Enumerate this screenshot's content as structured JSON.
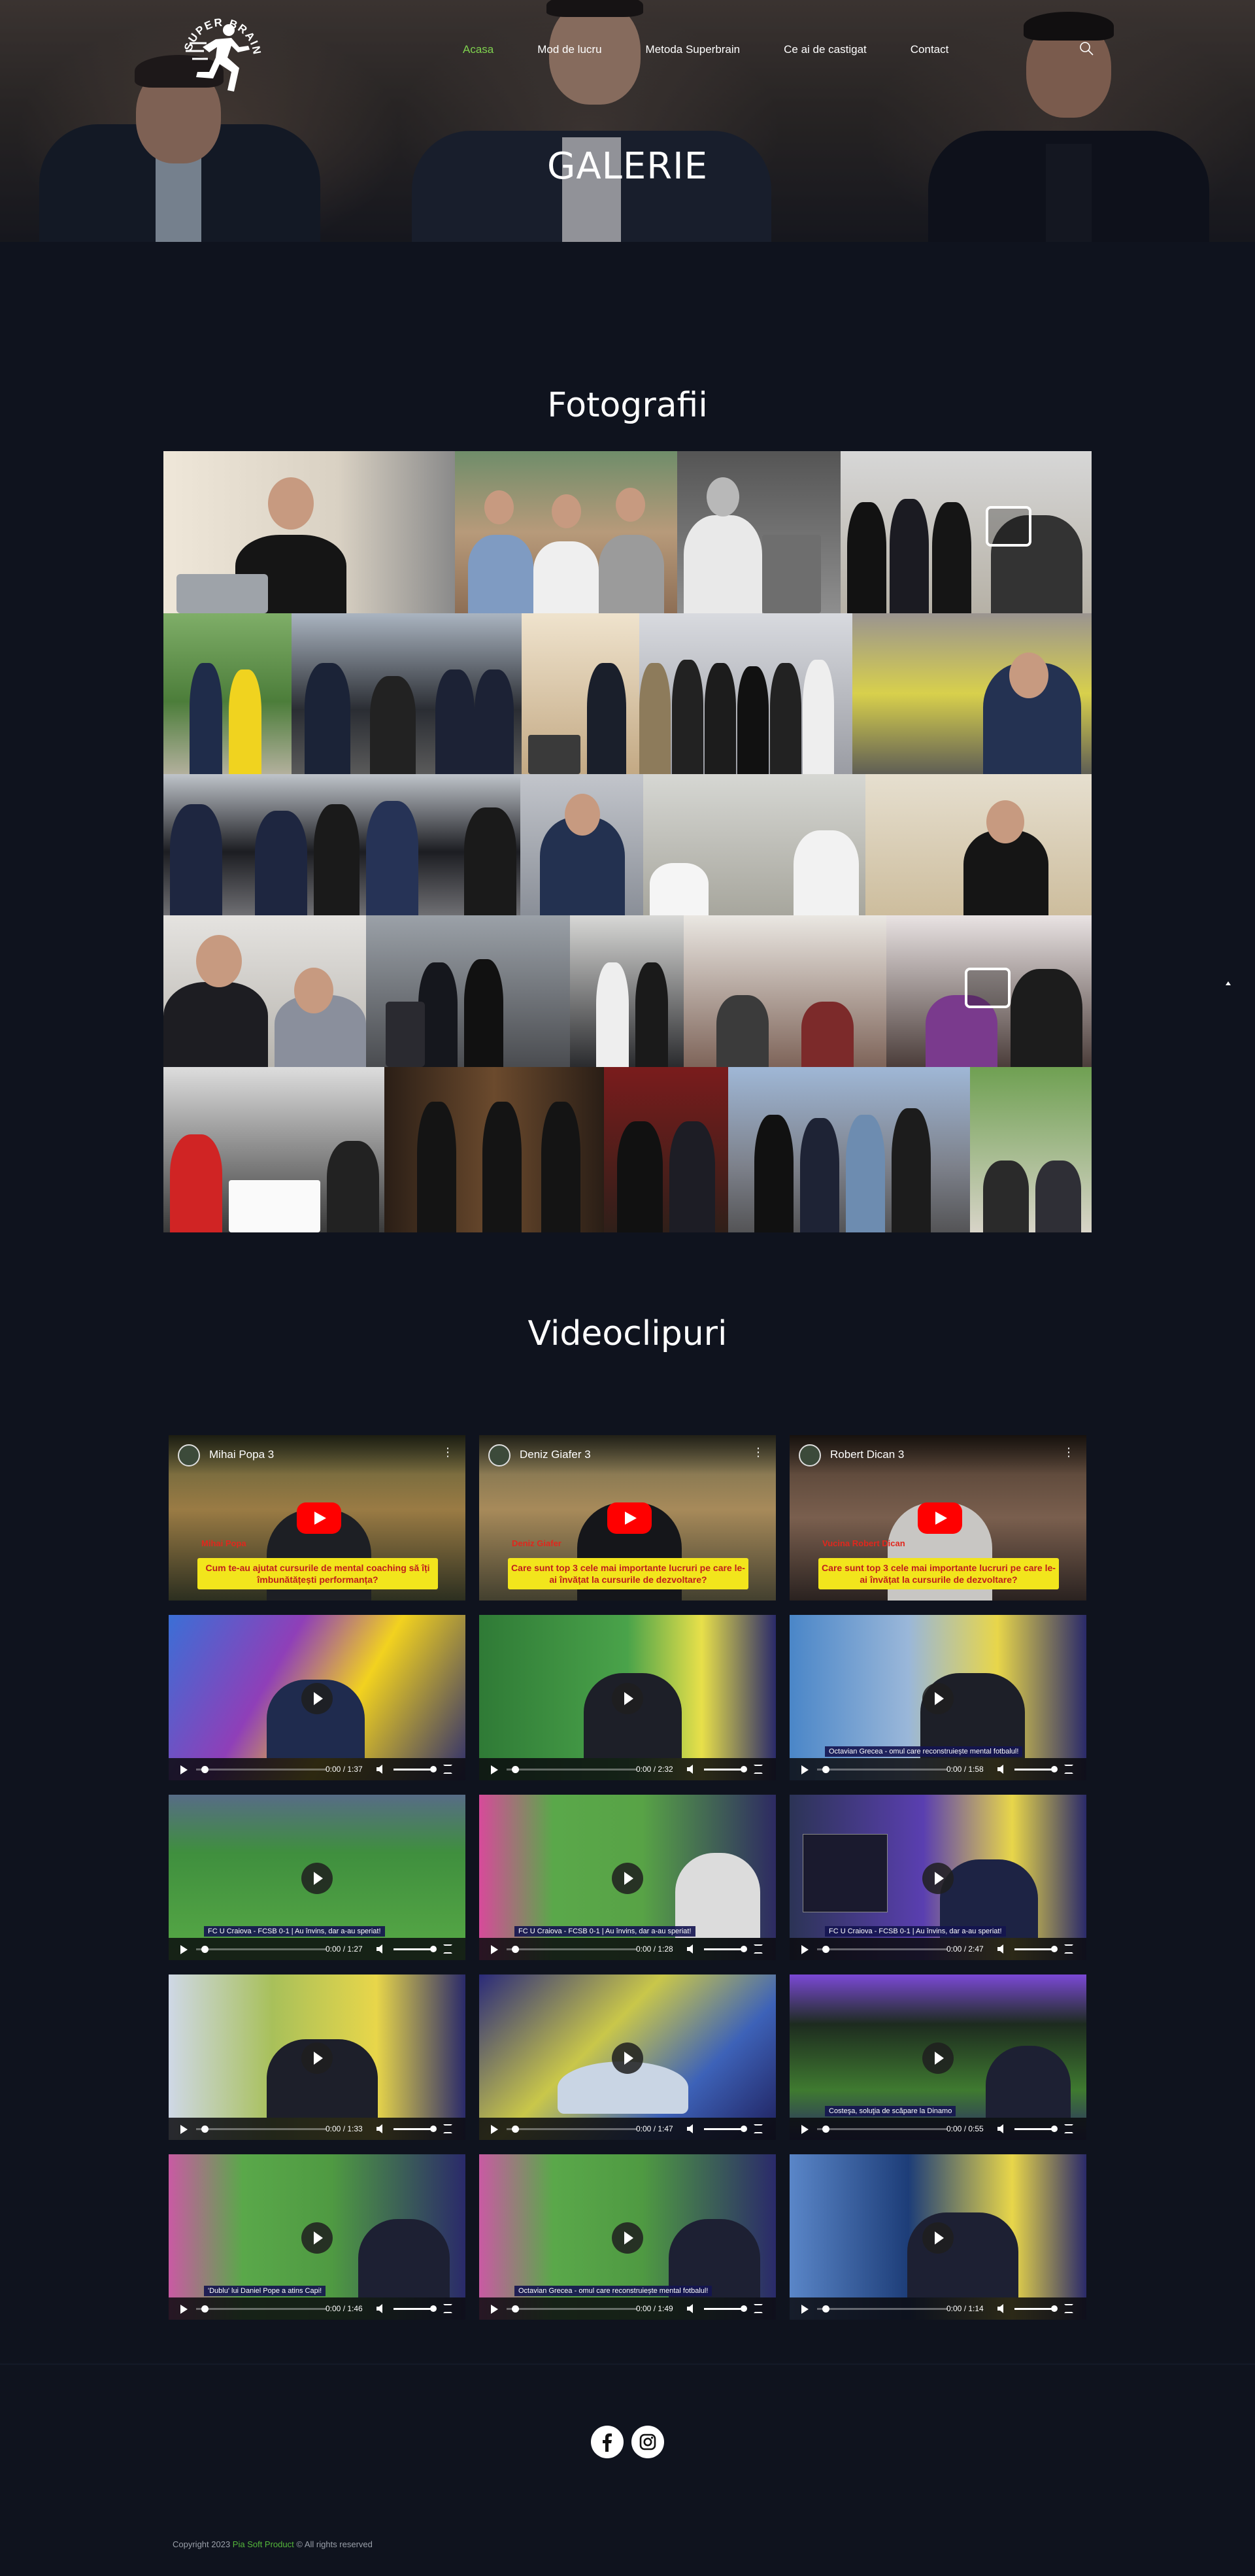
{
  "brand": {
    "logo_text": "SUPER BRAIN",
    "accent": "#7fd14f"
  },
  "nav": {
    "items": [
      {
        "label": "Acasa",
        "active": true
      },
      {
        "label": "Mod de lucru",
        "active": false
      },
      {
        "label": "Metoda Superbrain",
        "active": false
      },
      {
        "label": "Ce ai de castigat",
        "active": false
      },
      {
        "label": "Contact",
        "active": false
      }
    ],
    "search_icon": "search-icon"
  },
  "hero": {
    "title": "GALERIE"
  },
  "gallery": {
    "title": "Fotografii",
    "image_icon": "image-placeholder-icon"
  },
  "videos": {
    "title": "Videoclipuri",
    "youtube": [
      {
        "channel_title": "Mihai Popa 3",
        "name": "Mihai Popa",
        "banner": "Cum te-au ajutat cursurile de mental coaching să îți îmbunătățești performanța?"
      },
      {
        "channel_title": "Deniz Giafer 3",
        "name": "Deniz Giafer",
        "banner": "Care sunt top 3 cele mai importante lucruri pe care le-ai învățat la cursurile de dezvoltare?"
      },
      {
        "channel_title": "Robert Dican 3",
        "name": "Vucina Robert Dican",
        "banner": "Care sunt top 3 cele mai importante lucruri pe care le-ai învățat la cursurile de dezvoltare?"
      }
    ],
    "players": [
      {
        "time": "0:00 / 1:37",
        "caption": ""
      },
      {
        "time": "0:00 / 2:32",
        "caption": ""
      },
      {
        "time": "0:00 / 1:58",
        "caption": "Octavian Grecea - omul care reconstruiește mental fotbalul!"
      },
      {
        "time": "0:00 / 1:27",
        "caption": "FC U Craiova - FCSB 0-1 | Au învins, dar a-au speriat!"
      },
      {
        "time": "0:00 / 1:28",
        "caption": "FC U Craiova - FCSB 0-1 | Au învins, dar a-au speriat!"
      },
      {
        "time": "0:00 / 2:47",
        "caption": "FC U Craiova - FCSB 0-1 | Au învins, dar a-au speriat!"
      },
      {
        "time": "0:00 / 1:33",
        "caption": ""
      },
      {
        "time": "0:00 / 1:47",
        "caption": ""
      },
      {
        "time": "0:00 / 0:55",
        "caption": "Costeşa, soluţia de scăpare la Dinamo"
      },
      {
        "time": "0:00 / 1:46",
        "caption": "'Dublu' lui Daniel Pope a atins Capi!"
      },
      {
        "time": "0:00 / 1:49",
        "caption": "Octavian Grecea - omul care reconstruiește mental fotbalul!"
      },
      {
        "time": "0:00 / 1:14",
        "caption": ""
      }
    ]
  },
  "footer": {
    "social": [
      "facebook-icon",
      "instagram-icon"
    ],
    "copyright_prefix": "Copyright 2023",
    "copyright_brand": "Pia Soft Product",
    "copyright_suffix": "© All rights reserved"
  }
}
